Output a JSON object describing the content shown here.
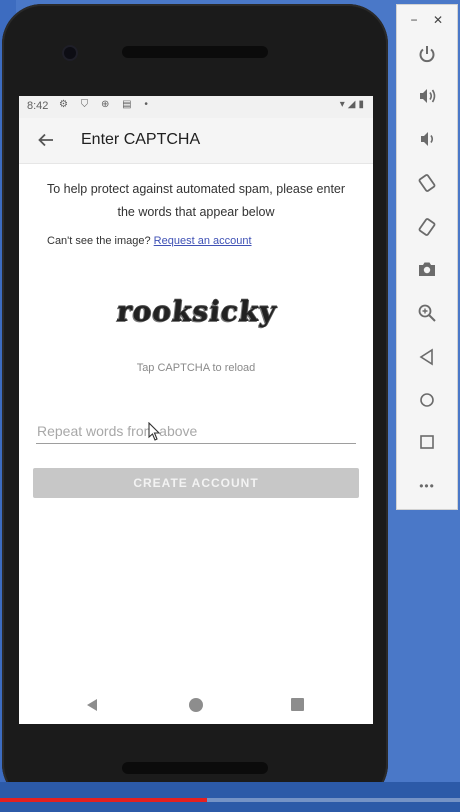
{
  "status_bar": {
    "time": "8:42",
    "left_icons": "⚙ ⛉ ⊕ ▤ •",
    "right_icons": "▾◢▮"
  },
  "app_bar": {
    "title": "Enter CAPTCHA",
    "back_icon": "arrow-left-icon"
  },
  "content": {
    "intro": "To help protect against automated spam, please enter the words that appear below",
    "help_prefix": "Can't see the image?",
    "help_link": "Request an account",
    "captcha_text": "rooksicky",
    "captcha_hint": "Tap CAPTCHA to reload",
    "input_placeholder": "Repeat words from above",
    "input_value": "",
    "create_button": "CREATE ACCOUNT"
  },
  "nav_bar": {
    "back_icon": "triangle-back-icon",
    "home_icon": "circle-home-icon",
    "recent_icon": "square-recents-icon"
  },
  "emulator_panel": {
    "minimize": "−",
    "close": "✕",
    "buttons": [
      "power-icon",
      "volume-up-icon",
      "volume-down-icon",
      "rotate-left-icon",
      "rotate-right-icon",
      "camera-icon",
      "zoom-icon",
      "back-icon",
      "home-icon",
      "overview-icon",
      "more-icon"
    ],
    "more_label": "•••"
  },
  "video_progress": 0.45,
  "colors": {
    "link": "#3f51b5",
    "button_disabled": "#c7c7c7",
    "desktop": "#4a78c8",
    "progress": "#e52020"
  }
}
